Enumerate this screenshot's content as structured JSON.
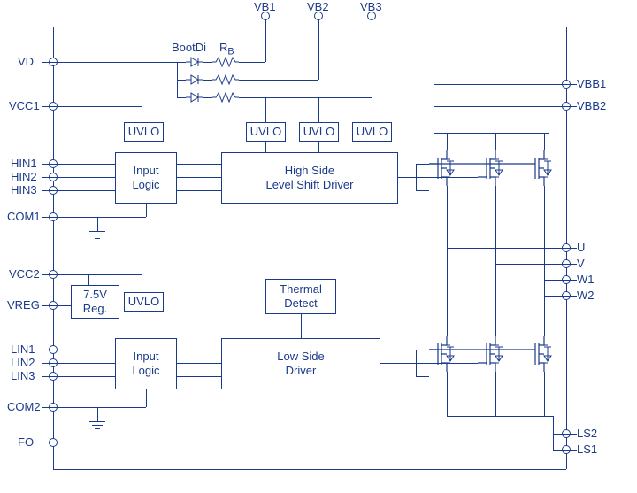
{
  "pins_top": {
    "vb1": "VB1",
    "vb2": "VB2",
    "vb3": "VB3"
  },
  "pins_left": {
    "vd": "VD",
    "vcc1": "VCC1",
    "hin1": "HIN1",
    "hin2": "HIN2",
    "hin3": "HIN3",
    "com1": "COM1",
    "vcc2": "VCC2",
    "vreg": "VREG",
    "lin1": "LIN1",
    "lin2": "LIN2",
    "lin3": "LIN3",
    "com2": "COM2",
    "fo": "FO"
  },
  "pins_right": {
    "vbb1": "VBB1",
    "vbb2": "VBB2",
    "u": "U",
    "v": "V",
    "w1": "W1",
    "w2": "W2",
    "ls2": "LS2",
    "ls1": "LS1"
  },
  "components": {
    "bootdi": "BootDi",
    "rb": "R",
    "rb_sub": "B",
    "uvlo": "UVLO",
    "input_logic": "Input\nLogic",
    "high_side_driver": "High Side\nLevel Shift Driver",
    "reg75": "7.5V\nReg.",
    "thermal": "Thermal\nDetect",
    "low_side_driver": "Low Side\nDriver"
  }
}
